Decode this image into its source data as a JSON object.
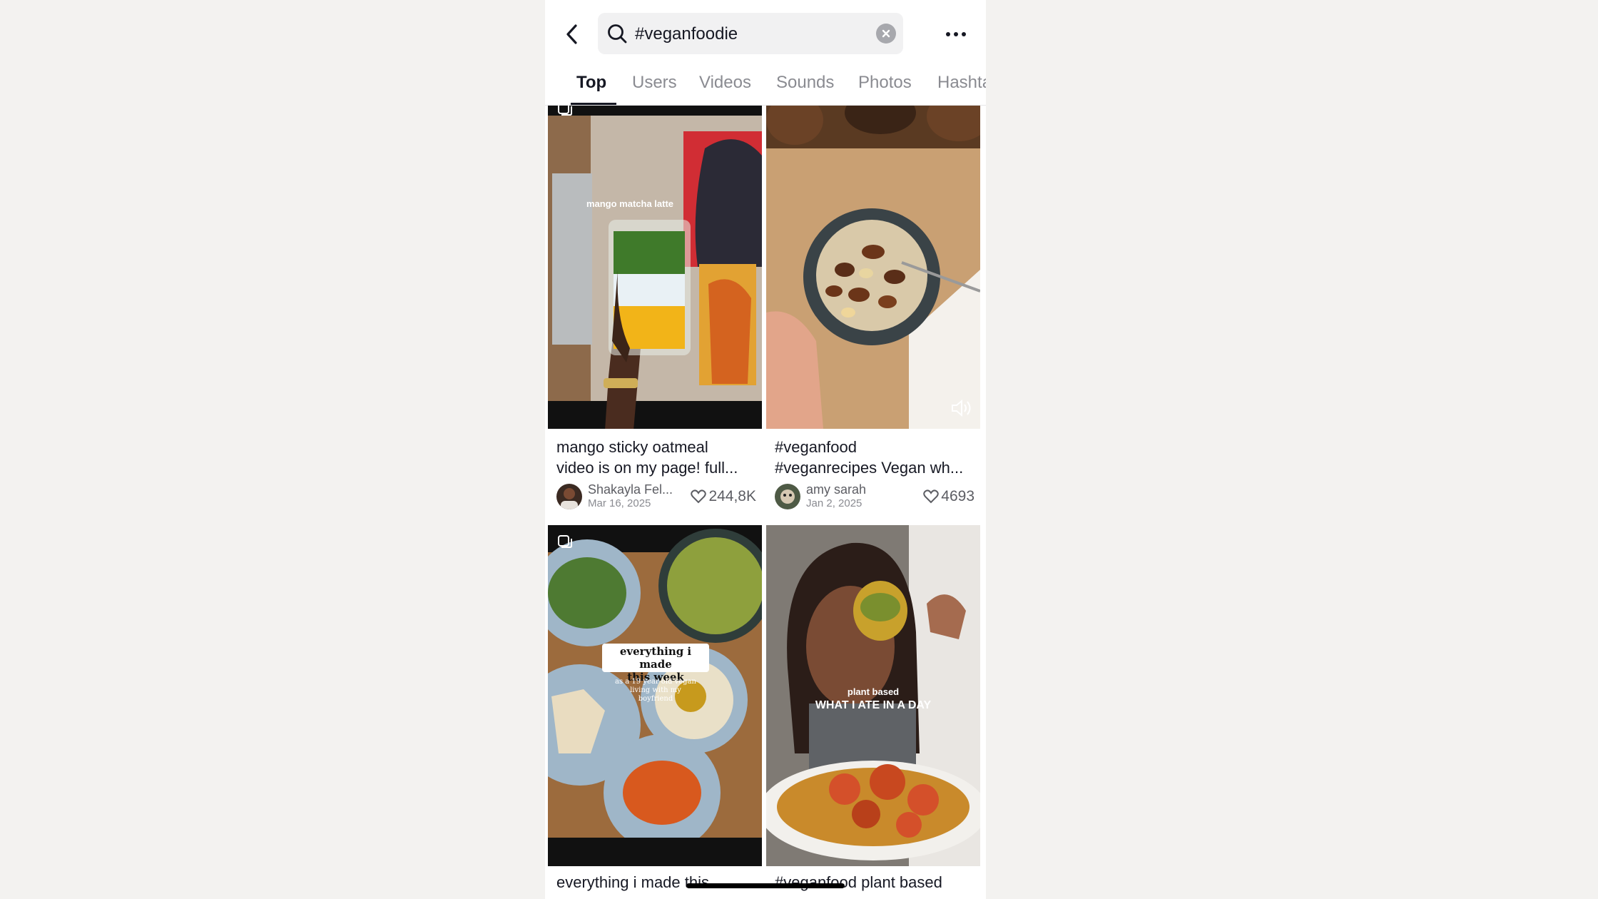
{
  "search": {
    "query": "#veganfoodie"
  },
  "tabs": [
    {
      "label": "Top",
      "active": true
    },
    {
      "label": "Users"
    },
    {
      "label": "Videos"
    },
    {
      "label": "Sounds"
    },
    {
      "label": "Photos"
    },
    {
      "label": "Hashtags"
    }
  ],
  "results": [
    {
      "overlay": "mango matcha latte",
      "caption_line1": "mango sticky oatmeal",
      "caption_line2": "video is on my page! full...",
      "author": "Shakayla Fel...",
      "date": "Mar 16, 2025",
      "likes": "244,8K"
    },
    {
      "caption_line1": "#veganfood",
      "caption_line2": "#veganrecipes Vegan wh...",
      "author": "amy sarah",
      "date": "Jan 2, 2025",
      "likes": "4693"
    },
    {
      "overlay_title_1": "everything i made",
      "overlay_title_2": "this week",
      "overlay_sub_1": "as a 19 year old vegan",
      "overlay_sub_2": "living with my",
      "overlay_sub_3": "boyfriend",
      "caption_line1": "everything i made this"
    },
    {
      "overlay_small": "plant based",
      "overlay_big": "WHAT I ATE IN A DAY",
      "caption_line1": "#veganfood  plant based"
    }
  ],
  "icons": {
    "back": "chevron-left-icon",
    "search": "search-icon",
    "clear": "clear-icon",
    "more": "more-icon",
    "carousel": "photo-carousel-icon",
    "sound": "sound-icon",
    "like": "heart-icon"
  }
}
